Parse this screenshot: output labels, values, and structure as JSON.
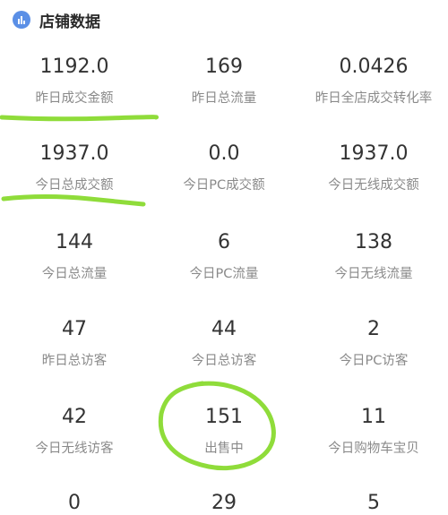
{
  "section": {
    "title": "店铺数据",
    "icon": "bar-chart-icon",
    "icon_color": "#5a8fe6"
  },
  "stats": [
    [
      {
        "value": "1192.0",
        "label": "昨日成交金额"
      },
      {
        "value": "169",
        "label": "昨日总流量"
      },
      {
        "value": "0.0426",
        "label": "昨日全店成交转化率"
      }
    ],
    [
      {
        "value": "1937.0",
        "label": "今日总成交额"
      },
      {
        "value": "0.0",
        "label": "今日PC成交额"
      },
      {
        "value": "1937.0",
        "label": "今日无线成交额"
      }
    ],
    [
      {
        "value": "144",
        "label": "今日总流量"
      },
      {
        "value": "6",
        "label": "今日PC流量"
      },
      {
        "value": "138",
        "label": "今日无线流量"
      }
    ],
    [
      {
        "value": "47",
        "label": "昨日总访客"
      },
      {
        "value": "44",
        "label": "今日总访客"
      },
      {
        "value": "2",
        "label": "今日PC访客"
      }
    ],
    [
      {
        "value": "42",
        "label": "今日无线访客"
      },
      {
        "value": "151",
        "label": "出售中"
      },
      {
        "value": "11",
        "label": "今日购物车宝贝"
      }
    ],
    [
      {
        "value": "0",
        "label": ""
      },
      {
        "value": "29",
        "label": ""
      },
      {
        "value": "5",
        "label": ""
      }
    ]
  ],
  "annotation_color": "#8fdc3a"
}
